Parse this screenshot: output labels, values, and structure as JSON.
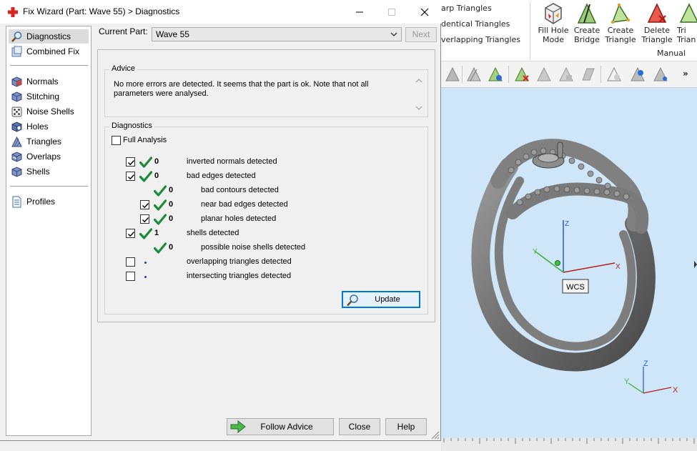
{
  "dialog": {
    "title": "Fix Wizard (Part: Wave 55) > Diagnostics",
    "current_part_label": "Current Part:",
    "current_part_value": "Wave 55",
    "next_label": "Next",
    "nav": {
      "items": [
        {
          "label": "Diagnostics",
          "icon": "magnifier-icon"
        },
        {
          "label": "Combined Fix",
          "icon": "combined-fix-icon"
        },
        {
          "label": "Normals",
          "icon": "cube-icon"
        },
        {
          "label": "Stitching",
          "icon": "cube-icon"
        },
        {
          "label": "Noise Shells",
          "icon": "dice-icon"
        },
        {
          "label": "Holes",
          "icon": "cube-icon"
        },
        {
          "label": "Triangles",
          "icon": "triangle-icon"
        },
        {
          "label": "Overlaps",
          "icon": "cube-icon"
        },
        {
          "label": "Shells",
          "icon": "cube-icon"
        },
        {
          "label": "Profiles",
          "icon": "document-icon"
        }
      ],
      "selected": "Diagnostics"
    },
    "advice": {
      "title": "Advice",
      "text": "No more errors are detected. It seems that the part is ok. Note that not all parameters were analysed."
    },
    "diagnostics": {
      "title": "Diagnostics",
      "full_analysis_label": "Full Analysis",
      "full_analysis_checked": false,
      "rows": [
        {
          "count": "0",
          "label": "inverted normals detected",
          "checked": true,
          "status": "ok"
        },
        {
          "count": "0",
          "label": "bad edges detected",
          "checked": true,
          "status": "ok"
        },
        {
          "count": "0",
          "label": "bad contours detected",
          "status": "ok"
        },
        {
          "count": "0",
          "label": "near bad edges detected",
          "checked": true,
          "status": "ok"
        },
        {
          "count": "0",
          "label": "planar holes detected",
          "checked": true,
          "status": "ok"
        },
        {
          "count": "1",
          "label": "shells detected",
          "checked": true,
          "status": "ok"
        },
        {
          "count": "0",
          "label": "possible noise shells detected",
          "status": "ok"
        },
        {
          "count": "",
          "label": "overlapping triangles detected",
          "checked": false,
          "status": "not-analysed"
        },
        {
          "count": "",
          "label": "intersecting triangles detected",
          "checked": false,
          "status": "not-analysed"
        }
      ],
      "update_label": "Update"
    },
    "buttons": {
      "follow_advice": "Follow Advice",
      "close": "Close",
      "help": "Help"
    }
  },
  "background_app": {
    "ribbon_list": [
      "arp Triangles",
      "dentical Triangles",
      "verlapping Triangles"
    ],
    "ribbon_buttons": [
      {
        "label1": "Fill Hole",
        "label2": "Mode"
      },
      {
        "label1": "Create",
        "label2": "Bridge"
      },
      {
        "label1": "Create",
        "label2": "Triangle"
      },
      {
        "label1": "Delete",
        "label2": "Triangle"
      },
      {
        "label1": "Tri",
        "label2": "Trian"
      }
    ],
    "ribbon_group": "Manual",
    "toolbar_more": "»",
    "viewport": {
      "wcs_label": "WCS",
      "axis_z": "Z",
      "axis_y": "Y",
      "axis_x": "X",
      "background": "#cfe6f9"
    }
  },
  "colors": {
    "accent": "#0078d7",
    "check_green": "#1e8a3a",
    "title_icon_red": "#d9231f"
  }
}
